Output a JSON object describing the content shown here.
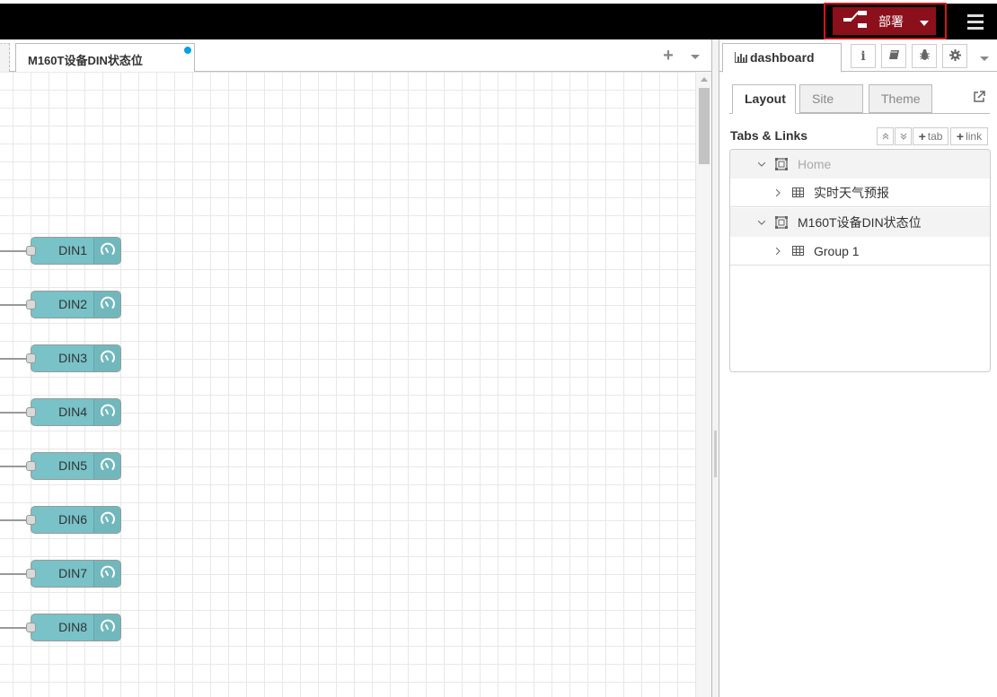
{
  "header": {
    "deploy_label": "部署",
    "deploy_icon": "deploy-icon",
    "menu_icon": "hamburger-menu-icon",
    "colors": {
      "bar": "#000000",
      "deploy_bg": "#8c101c",
      "highlight": "#d6141b"
    }
  },
  "workspace": {
    "active_tab": "M160T设备DIN状态位",
    "tab_changed": true,
    "add_tab_label": "+",
    "nodes": [
      {
        "label": "DIN1",
        "icon": "gauge-icon"
      },
      {
        "label": "DIN2",
        "icon": "gauge-icon"
      },
      {
        "label": "DIN3",
        "icon": "gauge-icon"
      },
      {
        "label": "DIN4",
        "icon": "gauge-icon"
      },
      {
        "label": "DIN5",
        "icon": "gauge-icon"
      },
      {
        "label": "DIN6",
        "icon": "gauge-icon"
      },
      {
        "label": "DIN7",
        "icon": "gauge-icon"
      },
      {
        "label": "DIN8",
        "icon": "gauge-icon"
      }
    ],
    "node_color": "#78c2c8"
  },
  "sidebar": {
    "active_tab": "dashboard",
    "icon_buttons": [
      "info-icon",
      "book-icon",
      "bug-icon",
      "gear-icon"
    ],
    "info_glyph": "i",
    "subtabs": [
      {
        "label": "Layout",
        "active": true
      },
      {
        "label": "Site",
        "active": false
      },
      {
        "label": "Theme",
        "active": false
      }
    ],
    "section_title": "Tabs & Links",
    "buttons": {
      "collapse": "collapse-all",
      "expand": "expand-all",
      "add_tab": "tab",
      "add_link": "link"
    },
    "tree": [
      {
        "type": "tab",
        "label": "Home",
        "disabled": true
      },
      {
        "type": "group",
        "label": "实时天气预报"
      },
      {
        "type": "tab",
        "label": "M160T设备DIN状态位",
        "disabled": false
      },
      {
        "type": "group",
        "label": "Group 1"
      }
    ]
  }
}
